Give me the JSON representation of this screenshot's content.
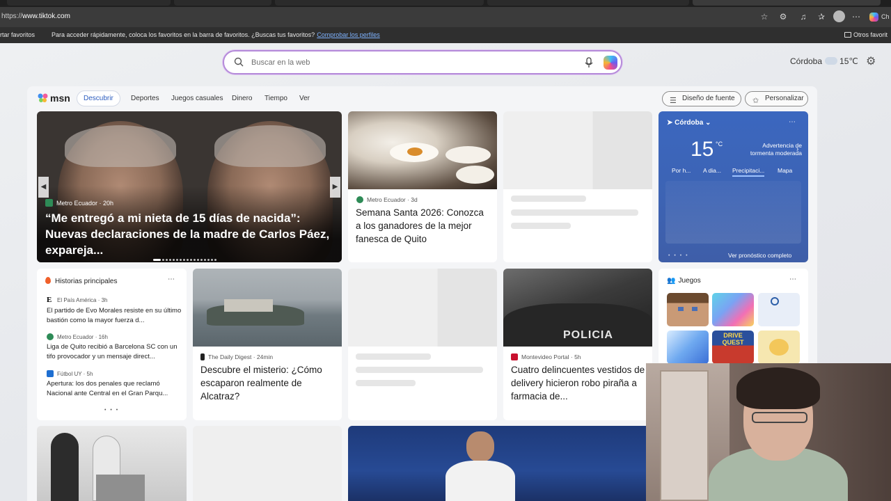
{
  "browser": {
    "url_prefix": "https://",
    "url_host": "www.tiktok.com",
    "favbar_import": "rtar favoritos",
    "favbar_message": "Para acceder rápidamente, coloca los favoritos en la barra de favoritos. ¿Buscas tus favoritos?",
    "favbar_link": "Comprobar los perfiles",
    "favbar_other": "Otros favorit",
    "profile_label": "Ch"
  },
  "search": {
    "placeholder": "Buscar en la web"
  },
  "top_weather": {
    "city": "Córdoba",
    "temp": "15℃"
  },
  "msn": {
    "logo": "msn",
    "nav": [
      "Descubrir",
      "Deportes",
      "Juegos casuales",
      "Dinero",
      "Tiempo",
      "Ver"
    ],
    "font_button": "Diseño de fuente",
    "personalize_button": "Personalizar"
  },
  "hero": {
    "source": "Metro Ecuador · 20h",
    "title": "“Me entregó a mi nieta de 15 días de nacida”: Nuevas declaraciones de la madre de Carlos Páez, expareja..."
  },
  "card_fanesca": {
    "source": "Metro Ecuador · 3d",
    "title": "Semana Santa 2026: Conozca a los ganadores de la mejor fanesca de Quito"
  },
  "weather_card": {
    "location": "Córdoba",
    "temp": "15",
    "unit": "°C",
    "warning": "Advertencia de tormenta moderada",
    "tabs": [
      "Por h...",
      "A dia...",
      "Precipitaci...",
      "Mapa"
    ],
    "full_forecast": "Ver pronóstico completo"
  },
  "historias": {
    "header": "Historias principales",
    "items": [
      {
        "source": "El País América · 3h",
        "title": "El partido de Evo Morales resiste en su último bastión como la mayor fuerza d..."
      },
      {
        "source": "Metro Ecuador · 16h",
        "title": "Liga de Quito recibió a Barcelona SC con un tifo provocador y un mensaje direct..."
      },
      {
        "source": "Fútbol UY · 5h",
        "title": "Apertura: los dos penales que reclamó Nacional ante Central en el Gran Parqu..."
      }
    ]
  },
  "card_alcatraz": {
    "source": "The Daily Digest · 24min",
    "title": "Descubre el misterio: ¿Cómo escaparon realmente de Alcatraz?"
  },
  "card_policia": {
    "image_text": "POLICIA",
    "source": "Montevideo Portal · 5h",
    "title": "Cuatro delincuentes vestidos de delivery hicieron robo piraña a farmacia de..."
  },
  "juegos": {
    "header": "Juegos",
    "tile_label": "DRIVE QUEST"
  },
  "colors": {
    "accent": "#2b5cbf",
    "weather_bg": "#3b67bf"
  }
}
